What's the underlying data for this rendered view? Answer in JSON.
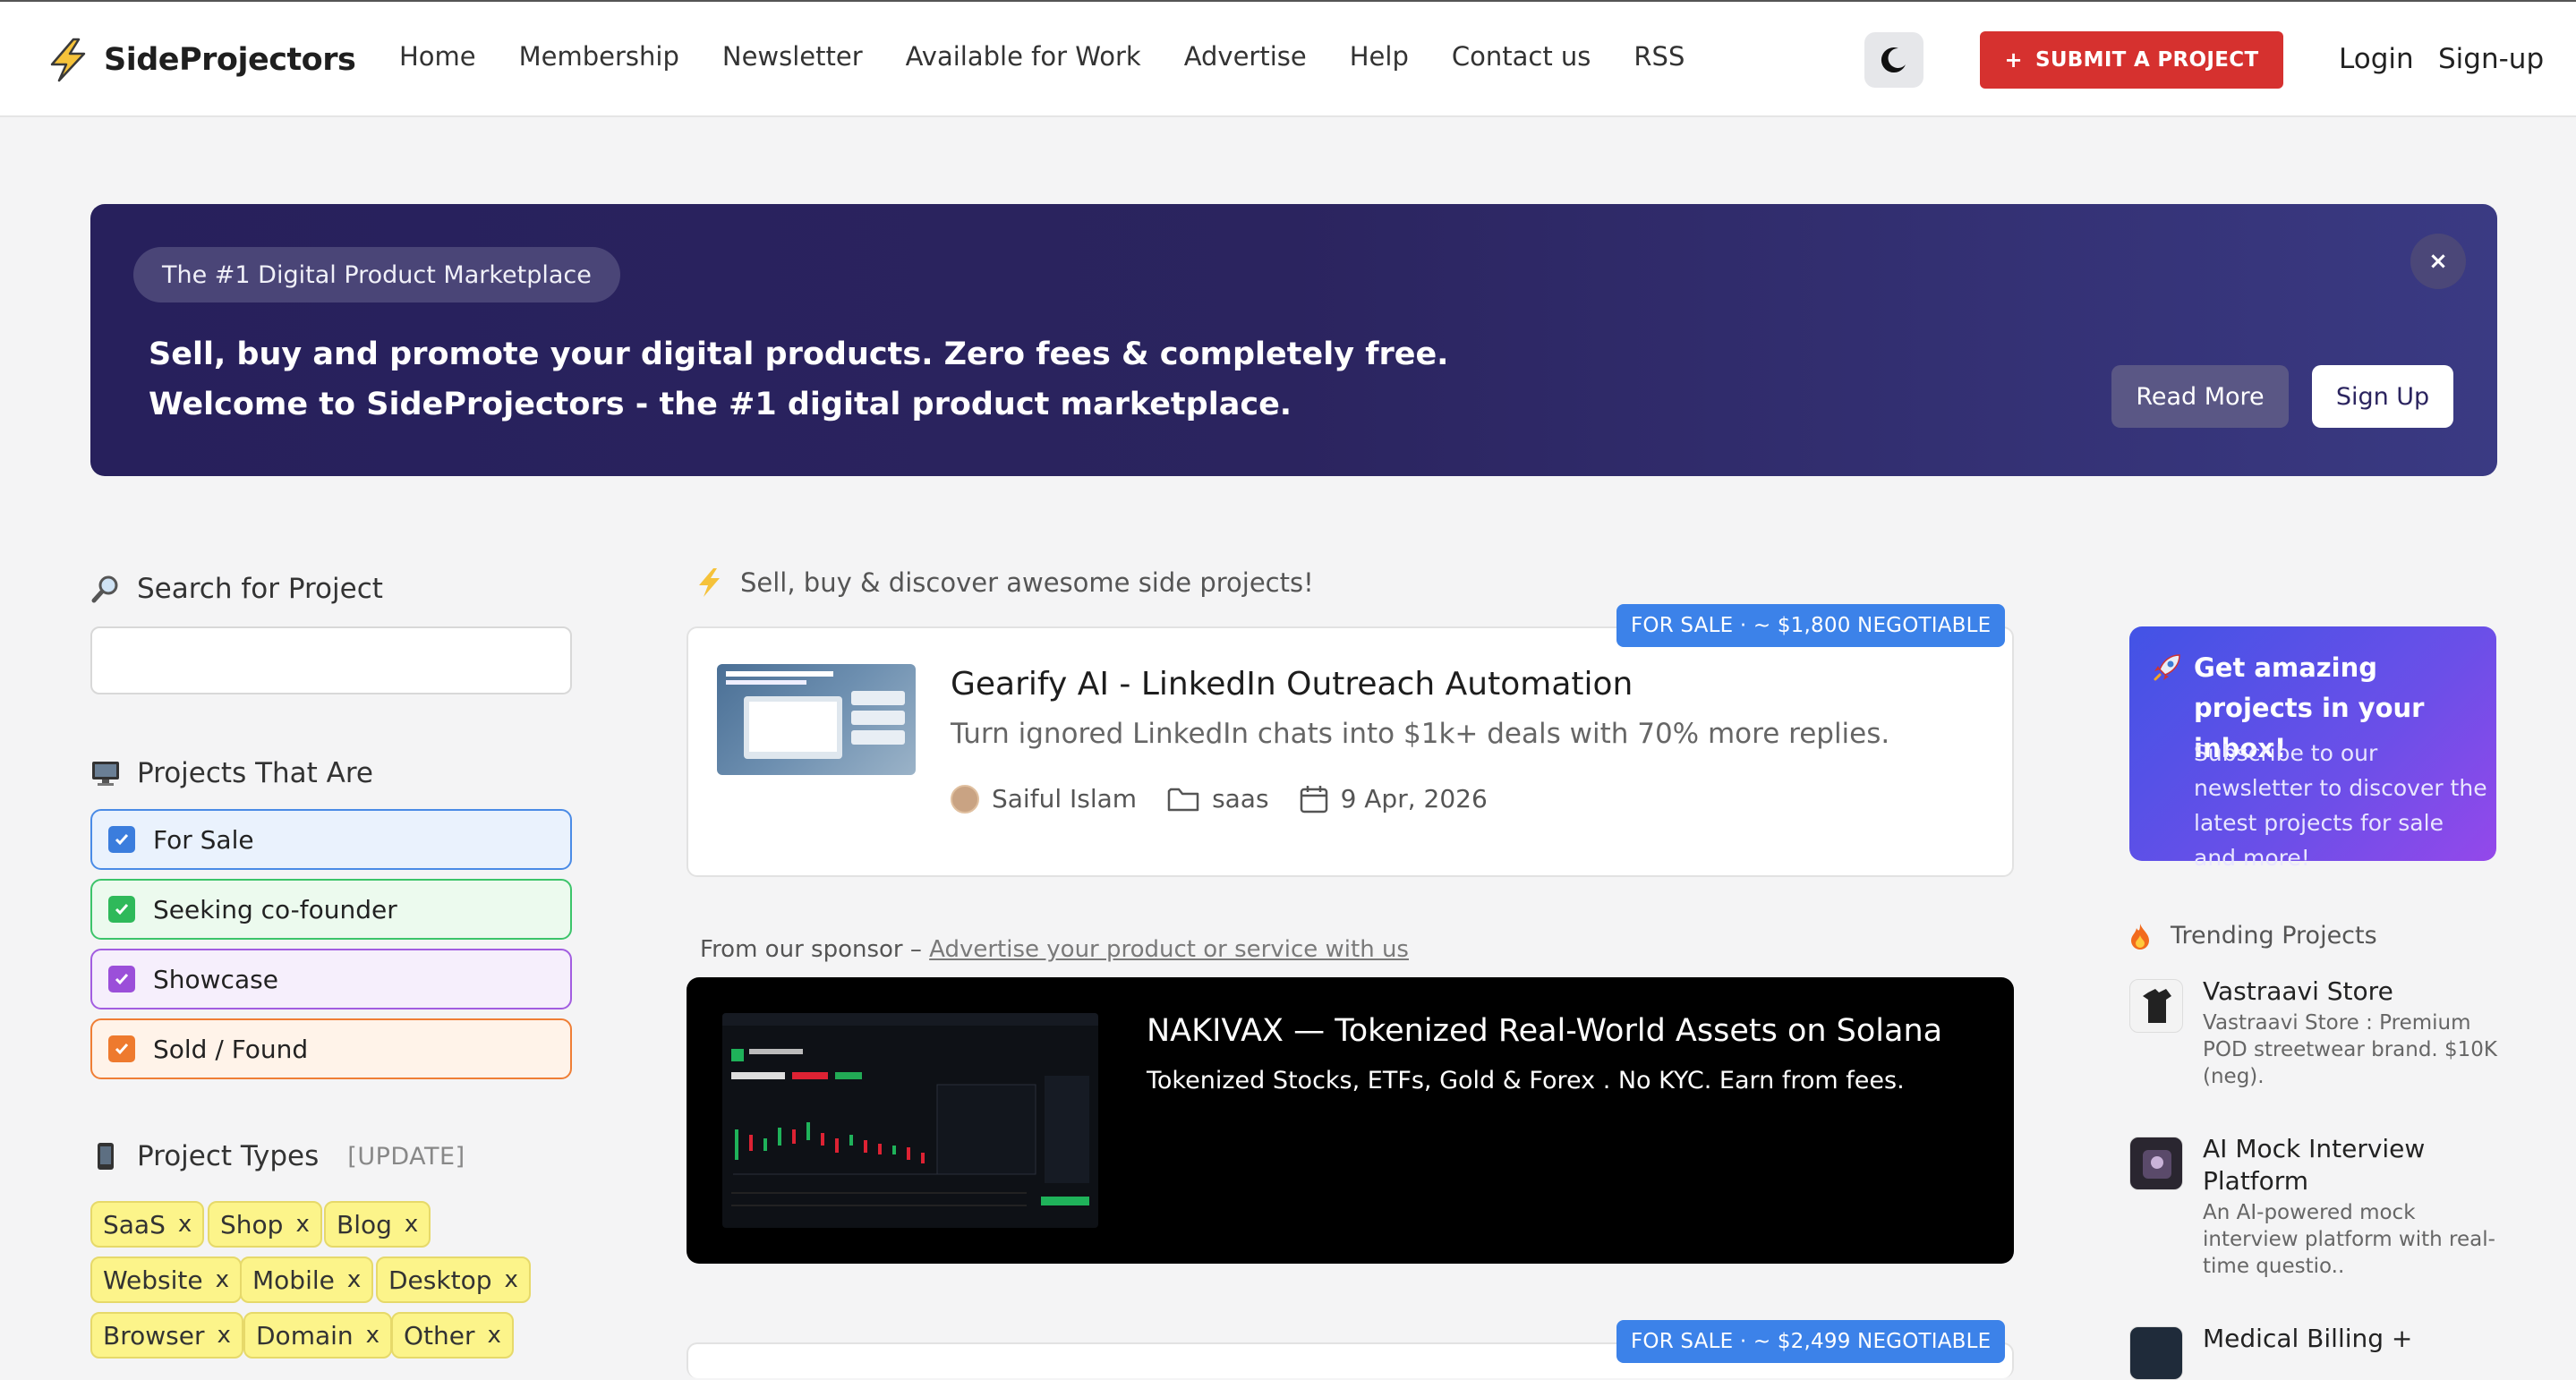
{
  "header": {
    "brand": "SideProjectors",
    "nav": [
      "Home",
      "Membership",
      "Newsletter",
      "Available for Work",
      "Advertise",
      "Help",
      "Contact us",
      "RSS"
    ],
    "submit_label": "SUBMIT A PROJECT",
    "submit_plus": "+",
    "login": "Login",
    "signup": "Sign-up"
  },
  "banner": {
    "pill": "The #1 Digital Product Marketplace",
    "line1": "Sell, buy and promote your digital products. Zero fees & completely free.",
    "line2": "Welcome to SideProjectors - the #1 digital product marketplace.",
    "close": "×",
    "read_more": "Read More",
    "sign_up": "Sign Up"
  },
  "sidebar": {
    "search_title": "Search for Project",
    "search_value": "",
    "filters_title": "Projects That Are",
    "filters": [
      {
        "label": "For Sale",
        "checked": true
      },
      {
        "label": "Seeking co-founder",
        "checked": true
      },
      {
        "label": "Showcase",
        "checked": true
      },
      {
        "label": "Sold / Found",
        "checked": true
      }
    ],
    "types_title": "Project Types",
    "types_update": "[UPDATE]",
    "types": [
      "SaaS",
      "Shop",
      "Blog",
      "Website",
      "Mobile",
      "Desktop",
      "Browser",
      "Domain",
      "Other"
    ],
    "tag_remove": "x"
  },
  "main": {
    "heading": "Sell, buy & discover awesome side projects!",
    "projects": [
      {
        "badge": "FOR SALE · ~ $1,800 NEGOTIABLE",
        "title": "Gearify AI - LinkedIn Outreach Automation",
        "description": "Turn ignored LinkedIn chats into $1k+ deals with 70% more replies.",
        "author": "Saiful Islam",
        "category": "saas",
        "date": "9 Apr, 2026"
      },
      {
        "badge": "FOR SALE · ~ $2,499 NEGOTIABLE"
      }
    ],
    "sponsor_prefix": "From our sponsor – ",
    "sponsor_link": "Advertise your product or service with us",
    "sponsor": {
      "title": "NAKIVAX — Tokenized Real-World Assets on Solana",
      "description": "Tokenized Stocks, ETFs, Gold & Forex . No KYC. Earn from fees."
    }
  },
  "right": {
    "newsletter_title": "Get amazing projects in your inbox!",
    "newsletter_body": "Subscribe to our newsletter to discover the latest projects for sale and more!",
    "trending_title": "Trending Projects",
    "trending": [
      {
        "name": "Vastraavi Store",
        "description": "Vastraavi Store : Premium POD streetwear brand. $10K (neg)."
      },
      {
        "name": "AI Mock Interview Platform",
        "description": "An AI-powered mock interview platform with real-time questio.."
      },
      {
        "name": "Medical Billing +",
        "description": ""
      }
    ]
  },
  "colors": {
    "accent_red": "#d6312f",
    "banner_bg": "#2b245f",
    "badge_blue": "#3c82e9",
    "tag_yellow": "#fcf48a"
  }
}
